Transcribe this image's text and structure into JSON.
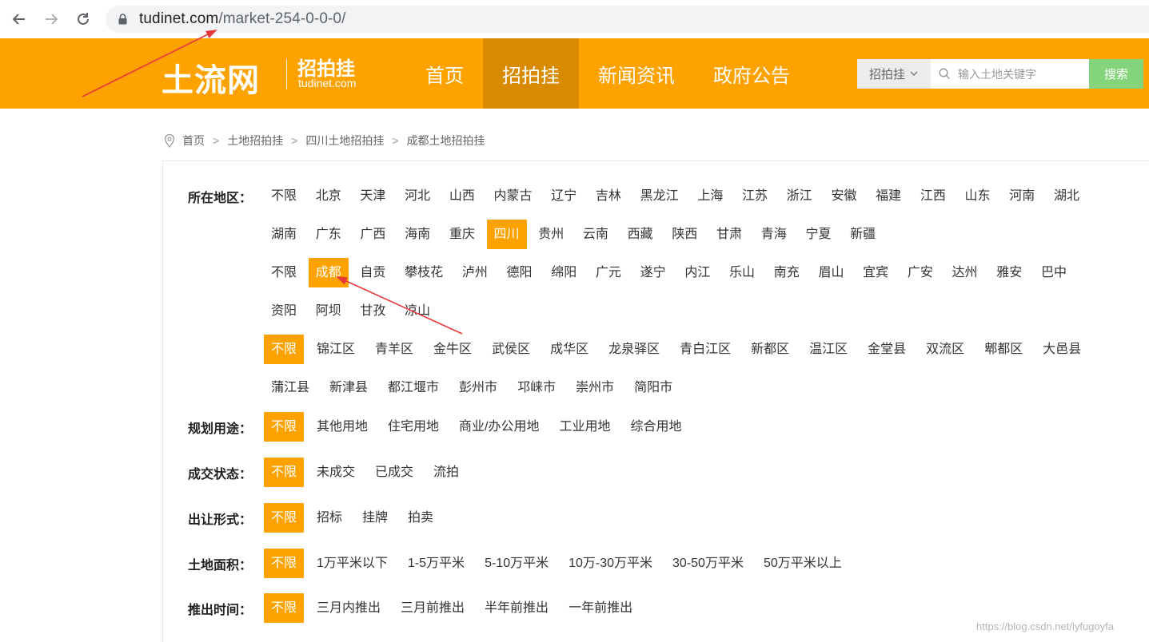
{
  "browser": {
    "url_domain": "tudinet.com",
    "url_path": "/market-254-0-0-0/"
  },
  "site": {
    "logo": "土流网",
    "logo_sub": "招拍挂",
    "logo_domain": "tudinet.com",
    "nav": [
      {
        "label": "首页",
        "active": false
      },
      {
        "label": "招拍挂",
        "active": true
      },
      {
        "label": "新闻资讯",
        "active": false
      },
      {
        "label": "政府公告",
        "active": false
      }
    ],
    "search": {
      "category": "招拍挂",
      "placeholder": "输入土地关键字",
      "button": "搜索"
    },
    "accent": "#fea200",
    "accent_dark": "#d88a01",
    "search_button_color": "#84d47c"
  },
  "breadcrumb": [
    "首页",
    "土地招拍挂",
    "四川土地招拍挂",
    "成都土地招拍挂"
  ],
  "filters": {
    "region": {
      "label": "所在地区：",
      "provinces": [
        "不限",
        "北京",
        "天津",
        "河北",
        "山西",
        "内蒙古",
        "辽宁",
        "吉林",
        "黑龙江",
        "上海",
        "江苏",
        "浙江",
        "安徽",
        "福建",
        "江西",
        "山东",
        "河南",
        "湖北",
        "湖南",
        "广东",
        "广西",
        "海南",
        "重庆",
        "四川",
        "贵州",
        "云南",
        "西藏",
        "陕西",
        "甘肃",
        "青海",
        "宁夏",
        "新疆"
      ],
      "province_selected": "四川",
      "cities": [
        "不限",
        "成都",
        "自贡",
        "攀枝花",
        "泸州",
        "德阳",
        "绵阳",
        "广元",
        "遂宁",
        "内江",
        "乐山",
        "南充",
        "眉山",
        "宜宾",
        "广安",
        "达州",
        "雅安",
        "巴中",
        "资阳",
        "阿坝",
        "甘孜",
        "凉山"
      ],
      "city_selected": "成都",
      "districts": [
        "不限",
        "锦江区",
        "青羊区",
        "金牛区",
        "武侯区",
        "成华区",
        "龙泉驿区",
        "青白江区",
        "新都区",
        "温江区",
        "金堂县",
        "双流区",
        "郫都区",
        "大邑县",
        "蒲江县",
        "新津县",
        "都江堰市",
        "彭州市",
        "邛崃市",
        "崇州市",
        "简阳市"
      ],
      "district_selected": "不限"
    },
    "usage": {
      "label": "规划用途：",
      "options": [
        "不限",
        "其他用地",
        "住宅用地",
        "商业/办公用地",
        "工业用地",
        "综合用地"
      ],
      "selected": "不限"
    },
    "status": {
      "label": "成交状态：",
      "options": [
        "不限",
        "未成交",
        "已成交",
        "流拍"
      ],
      "selected": "不限"
    },
    "transfer": {
      "label": "出让形式：",
      "options": [
        "不限",
        "招标",
        "挂牌",
        "拍卖"
      ],
      "selected": "不限"
    },
    "area": {
      "label": "土地面积：",
      "options": [
        "不限",
        "1万平米以下",
        "1-5万平米",
        "5-10万平米",
        "10万-30万平米",
        "30-50万平米",
        "50万平米以上"
      ],
      "selected": "不限"
    },
    "time": {
      "label": "推出时间：",
      "options": [
        "不限",
        "三月内推出",
        "三月前推出",
        "半年前推出",
        "一年前推出"
      ],
      "selected": "不限"
    }
  },
  "watermark": "https://blog.csdn.net/lyfugoyfa",
  "annotation_color": "#e8393a"
}
